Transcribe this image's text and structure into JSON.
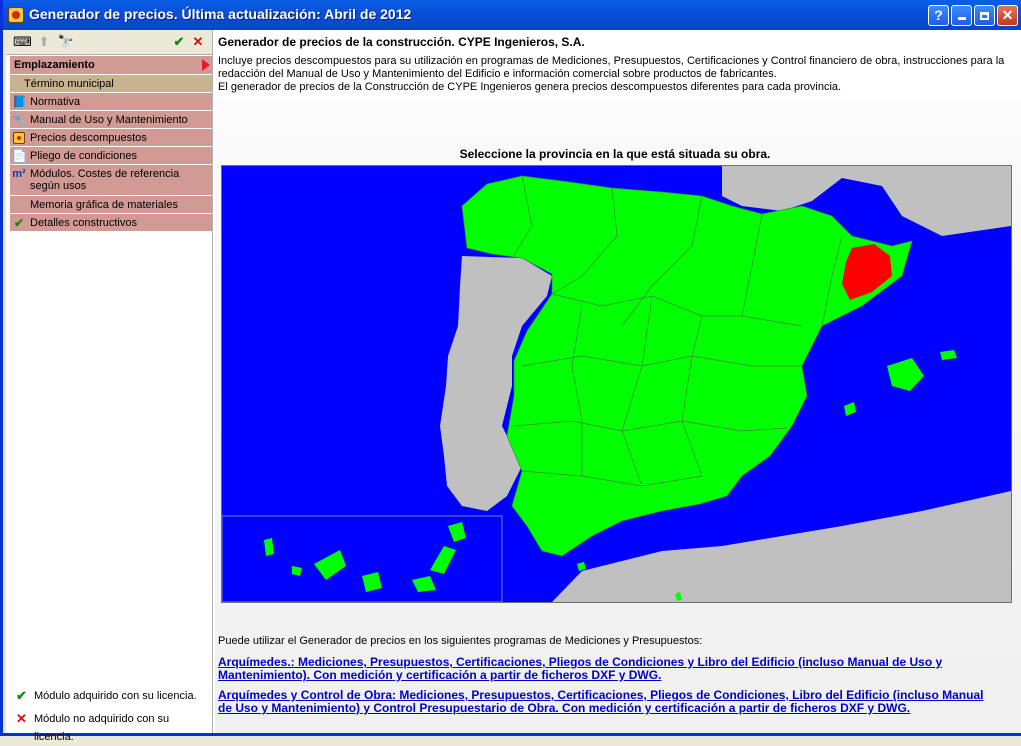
{
  "window": {
    "title": "Generador de precios. Última actualización: Abril de 2012"
  },
  "titlebar_buttons": {
    "help": "?",
    "minimize": "_",
    "maximize": "□",
    "close": "✕"
  },
  "left": {
    "nav": {
      "header": "Emplazamiento",
      "sub": "Término municipal",
      "items": [
        {
          "label": "Normativa",
          "icon": "book-icon"
        },
        {
          "label": "Manual de Uso y Mantenimiento",
          "icon": "wrench-icon"
        },
        {
          "label": "Precios descompuestos",
          "icon": "price-icon"
        },
        {
          "label": "Pliego de condiciones",
          "icon": "document-icon"
        },
        {
          "label": "Módulos. Costes de referencia según usos",
          "icon": "modules-icon"
        },
        {
          "label": "Memoria gráfica de materiales",
          "icon": ""
        },
        {
          "label": "Detalles constructivos",
          "icon": "check-icon"
        }
      ]
    },
    "legend": {
      "acquired": "Módulo adquirido con su licencia.",
      "not_acquired": "Módulo no adquirido con su licencia."
    }
  },
  "main": {
    "title": "Generador de precios de la construcción. CYPE Ingenieros, S.A.",
    "desc": [
      "Incluye precios descompuestos para su utilización en programas de Mediciones, Presupuestos, Certificaciones y Control financiero de obra, instrucciones para la",
      "redacción del Manual de Uso y Mantenimiento del Edificio e información comercial sobre productos de fabricantes.",
      "El generador de precios de la Construcción de CYPE Ingenieros genera precios descompuestos diferentes para cada provincia."
    ],
    "map_prompt": "Seleccione la provincia en la que está situada su obra.",
    "use_in": "Puede utilizar el Generador de precios en los siguientes programas de Mediciones y Presupuestos:",
    "links": [
      "Arquímedes.: Mediciones, Presupuestos, Certificaciones, Pliegos de Condiciones y Libro del Edificio (incluso Manual de Uso y Mantenimiento). Con medición y certificación a partir de ficheros DXF y DWG.",
      "Arquímedes y Control de Obra: Mediciones, Presupuestos, Certificaciones, Pliegos de Condiciones, Libro del Edificio (incluso Manual de Uso y Mantenimiento) y Control Presupuestario de Obra. Con medición y certificación a partir de ficheros DXF y DWG."
    ]
  },
  "colors": {
    "sea": "#0000ff",
    "land_selectable": "#00ff00",
    "land_selected": "#ff0000",
    "land_other": "#c0c0c0",
    "nav_item": "#d19a94",
    "nav_sub": "#c8b391"
  }
}
